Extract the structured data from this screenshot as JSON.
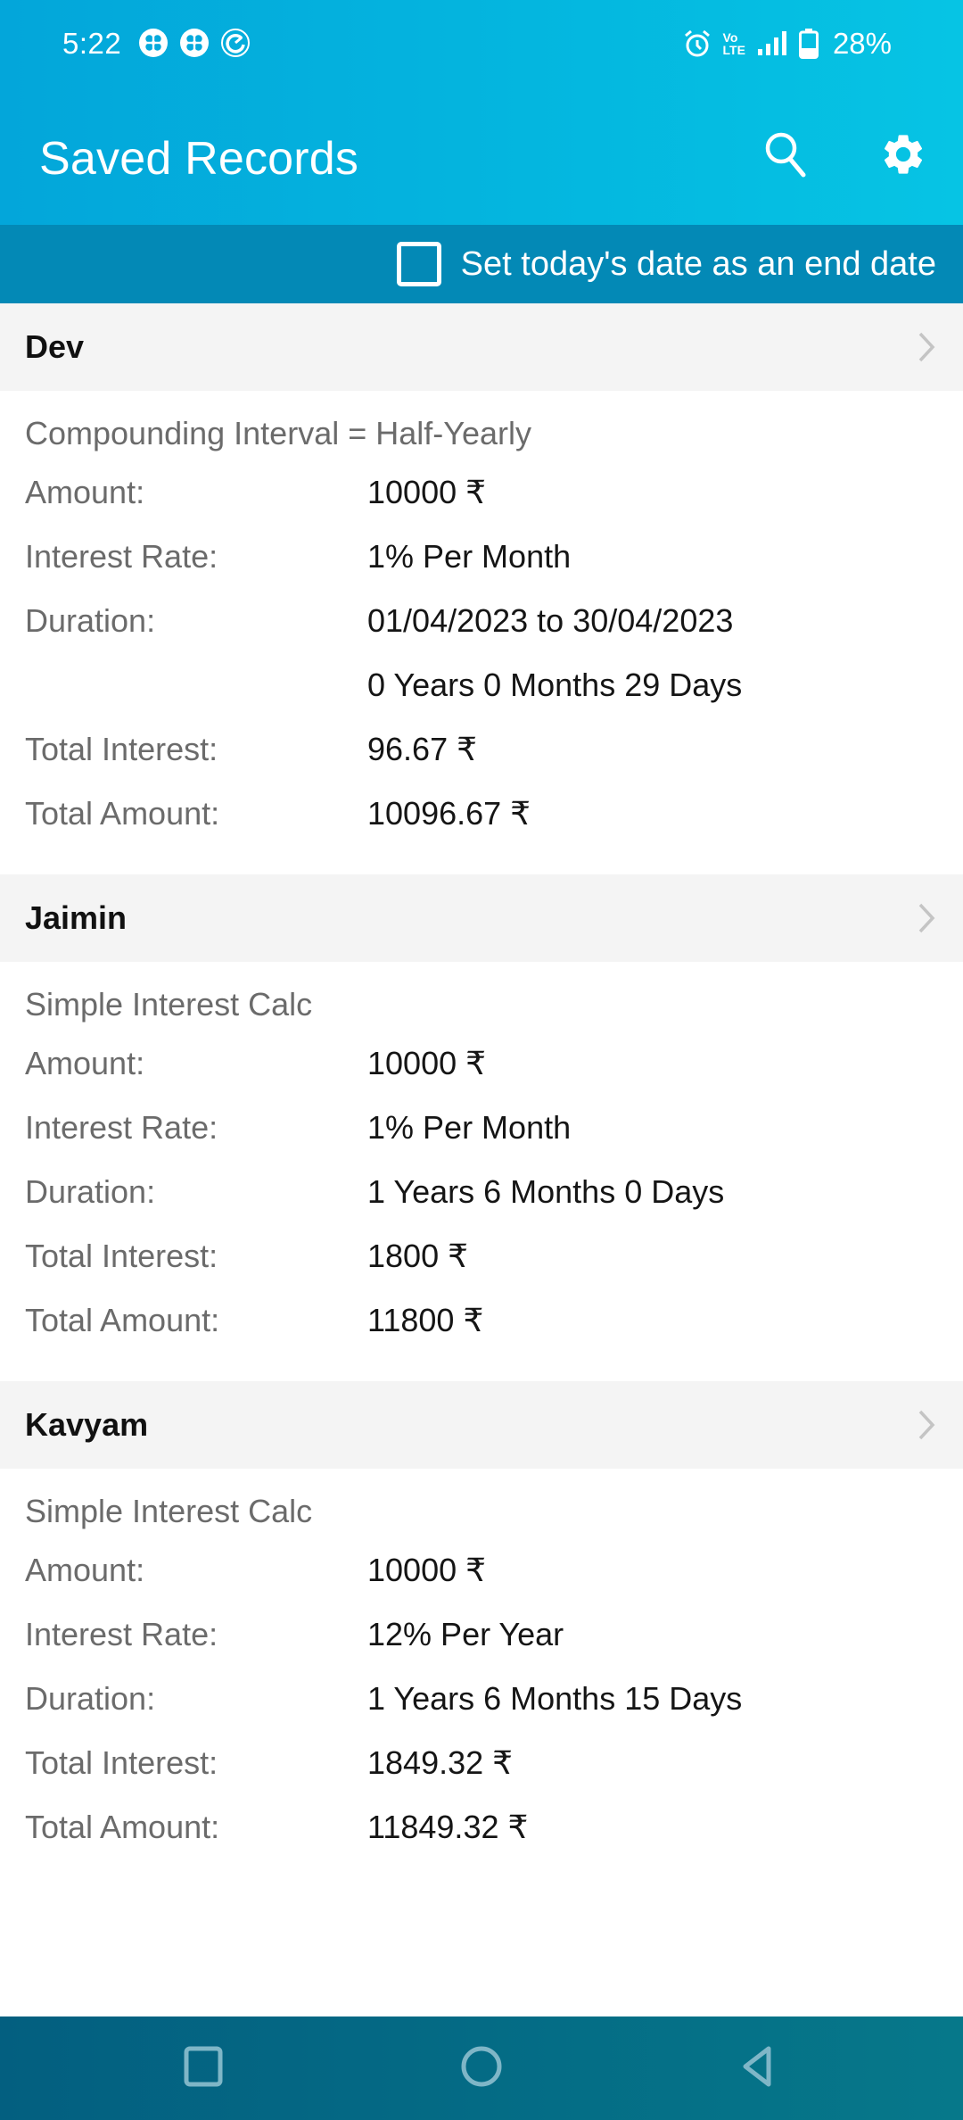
{
  "status_bar": {
    "time": "5:22",
    "left_icons": [
      "notification-app-icon",
      "notification-app-icon",
      "sync-gauge-icon"
    ],
    "right_icons": [
      "alarm-icon",
      "volte-icon",
      "signal-icon",
      "battery-icon"
    ],
    "volte_top": "Vo",
    "volte_bottom": "LTE",
    "battery_percent": "28%"
  },
  "app_bar": {
    "title": "Saved Records",
    "actions": [
      "search-icon",
      "gear-icon"
    ]
  },
  "sub_bar": {
    "checkbox_label": "Set today's date as an end date",
    "checked": false
  },
  "records": [
    {
      "name": "Dev",
      "type": "Compounding Interval = Half-Yearly",
      "amount_label": "Amount:",
      "amount": "10000 ₹",
      "rate_label": "Interest Rate:",
      "rate": "1% Per Month",
      "duration_label": "Duration:",
      "duration_dates": "01/04/2023 to 30/04/2023",
      "duration": "0 Years 0 Months 29 Days",
      "total_interest_label": "Total Interest:",
      "total_interest": "96.67 ₹",
      "total_amount_label": "Total Amount:",
      "total_amount": "10096.67 ₹"
    },
    {
      "name": "Jaimin",
      "type": "Simple Interest Calc",
      "amount_label": "Amount:",
      "amount": "10000 ₹",
      "rate_label": "Interest Rate:",
      "rate": "1% Per Month",
      "duration_label": "Duration:",
      "duration": "1 Years 6 Months 0 Days",
      "total_interest_label": "Total Interest:",
      "total_interest": "1800 ₹",
      "total_amount_label": "Total Amount:",
      "total_amount": "11800 ₹"
    },
    {
      "name": "Kavyam",
      "type": "Simple Interest Calc",
      "amount_label": "Amount:",
      "amount": "10000 ₹",
      "rate_label": "Interest Rate:",
      "rate": "12% Per Year",
      "duration_label": "Duration:",
      "duration": "1 Years 6 Months 15 Days",
      "total_interest_label": "Total Interest:",
      "total_interest": "1849.32 ₹",
      "total_amount_label": "Total Amount:",
      "total_amount": "11849.32 ₹"
    }
  ],
  "nav_bar": {
    "buttons": [
      "recents-icon",
      "home-icon",
      "back-icon"
    ]
  },
  "colors": {
    "app_bar": "#04b6df",
    "sub_bar": "#0389b6",
    "record_header_bg": "#f4f4f4",
    "label_text": "#6b6b6b",
    "value_text": "#151515",
    "nav_bar": "#046b85"
  }
}
